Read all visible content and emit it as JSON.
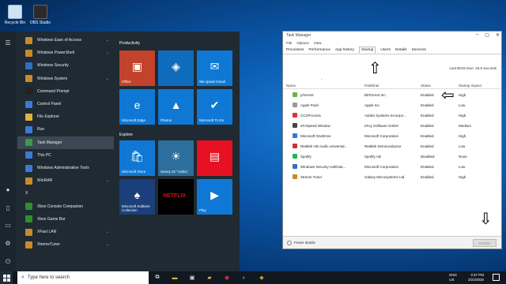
{
  "desktop": {
    "icons": [
      {
        "label": "Recycle Bin",
        "icon": "recycle-bin-icon",
        "color": "#cfe3f4"
      },
      {
        "label": "OBS Studio",
        "icon": "obs-icon",
        "color": "#2a2a2a"
      }
    ]
  },
  "start_menu": {
    "rail_icons": [
      "hamburger-menu-icon",
      "user-icon",
      "document-icon",
      "pictures-icon",
      "settings-icon",
      "power-icon"
    ],
    "apps": [
      {
        "label": "Windows Ease of Access",
        "color": "#c98a2b",
        "chevron": true
      },
      {
        "label": "Windows PowerShell",
        "color": "#c98a2b",
        "chevron": true
      },
      {
        "label": "Windows Security",
        "color": "#2f6fbf",
        "chevron": false
      },
      {
        "label": "Windows System",
        "color": "#c98a2b",
        "chevron": true
      },
      {
        "label": "Command Prompt",
        "color": "#222",
        "chevron": false
      },
      {
        "label": "Control Panel",
        "color": "#3a7bd5",
        "chevron": false
      },
      {
        "label": "File Explorer",
        "color": "#e2b33c",
        "chevron": false
      },
      {
        "label": "Run",
        "color": "#3a7bd5",
        "chevron": false
      },
      {
        "label": "Task Manager",
        "color": "#3a9a4a",
        "chevron": false,
        "selected": true
      },
      {
        "label": "This PC",
        "color": "#3a7bd5",
        "chevron": false
      },
      {
        "label": "Windows Administrative Tools",
        "color": "#3a7bd5",
        "chevron": false
      },
      {
        "label": "WinRAR",
        "color": "#c98a2b",
        "chevron": true
      },
      {
        "label": "X",
        "color": "#1f2a33",
        "chevron": false,
        "header": true
      },
      {
        "label": "Xbox Console Companion",
        "color": "#2f8f2f",
        "chevron": false
      },
      {
        "label": "Xbox Game Bar",
        "color": "#2f8f2f",
        "chevron": false
      },
      {
        "label": "XFast LAN",
        "color": "#c98a2b",
        "chevron": true
      },
      {
        "label": "XtremeTuner",
        "color": "#c98a2b",
        "chevron": true
      }
    ],
    "groups": {
      "productivity": "Productivity",
      "explore": "Explore"
    },
    "tiles": [
      {
        "label": "Office",
        "color": "#c2422b",
        "glyph": "▣"
      },
      {
        "label": "",
        "color": "#0f6cbd",
        "glyph": "◈"
      },
      {
        "label": "We speak Gmail",
        "color": "#0f78d4",
        "glyph": "✉"
      },
      {
        "label": "Microsoft Edge",
        "color": "#0f78d4",
        "glyph": "e"
      },
      {
        "label": "Photos",
        "color": "#0f78d4",
        "glyph": "▲"
      },
      {
        "label": "Microsoft To Do",
        "color": "#0f78d4",
        "glyph": "✔"
      },
      {
        "label": "Microsoft Store",
        "color": "#0f78d4",
        "glyph": "🛍"
      },
      {
        "label": "Sunny 31° Kabul",
        "color": "#2c6e9c",
        "glyph": "☀"
      },
      {
        "label": "",
        "color": "#e81123",
        "glyph": "▤"
      },
      {
        "label": "Microsoft Solitaire Collection",
        "color": "#1b3f7a",
        "glyph": "♠"
      },
      {
        "label": "NETFLIX",
        "color": "#000000",
        "glyph": ""
      },
      {
        "label": "Play",
        "color": "#0f78d4",
        "glyph": "▶"
      }
    ]
  },
  "task_manager": {
    "title": "Task Manager",
    "menu": [
      "File",
      "Options",
      "View"
    ],
    "tabs": [
      "Processes",
      "Performance",
      "App history",
      "Startup",
      "Users",
      "Details",
      "Services"
    ],
    "active_tab": "Startup",
    "last_bios": "Last BIOS time:   25.5 seconds",
    "columns": {
      "name": "Name",
      "publisher": "Publisher",
      "status": "Status",
      "impact": "Startup impact"
    },
    "rows": [
      {
        "name": "µTorrent",
        "publisher": "BitTorrent Inc.",
        "status": "Enabled",
        "impact": "High",
        "color": "#6ab04c"
      },
      {
        "name": "Apple Push",
        "publisher": "Apple Inc.",
        "status": "Enabled",
        "impact": "Low",
        "color": "#999"
      },
      {
        "name": "CCXProcess",
        "publisher": "Adobe Systems Incorpor...",
        "status": "Enabled",
        "impact": "High",
        "color": "#d33"
      },
      {
        "name": "eFxSpeed Window",
        "publisher": "eFxy Software GmbH",
        "status": "Enabled",
        "impact": "Medium",
        "color": "#444"
      },
      {
        "name": "Microsoft OneDrive",
        "publisher": "Microsoft Corporation",
        "status": "Enabled",
        "impact": "High",
        "color": "#2b7cd3"
      },
      {
        "name": "Realtek HD Audio Universal...",
        "publisher": "Realtek Semiconductor",
        "status": "Enabled",
        "impact": "Low",
        "color": "#c33"
      },
      {
        "name": "Spotify",
        "publisher": "Spotify AB",
        "status": "Disabled",
        "impact": "None",
        "color": "#1db954"
      },
      {
        "name": "Windows Security notificati...",
        "publisher": "Microsoft Corporation",
        "status": "Enabled",
        "impact": "Low",
        "color": "#2f6fbf"
      },
      {
        "name": "Xtreme Tuner",
        "publisher": "Galaxy Microsystems Ltd.",
        "status": "Enabled",
        "impact": "High",
        "color": "#c98a2b"
      }
    ],
    "fewer_details": "Fewer details",
    "disable_button": "Disable"
  },
  "taskbar": {
    "search_placeholder": "Type here to search",
    "tray_lang": "ENG",
    "tray_region": "US",
    "time": "3:37 PM",
    "date": "2/22/2020"
  }
}
